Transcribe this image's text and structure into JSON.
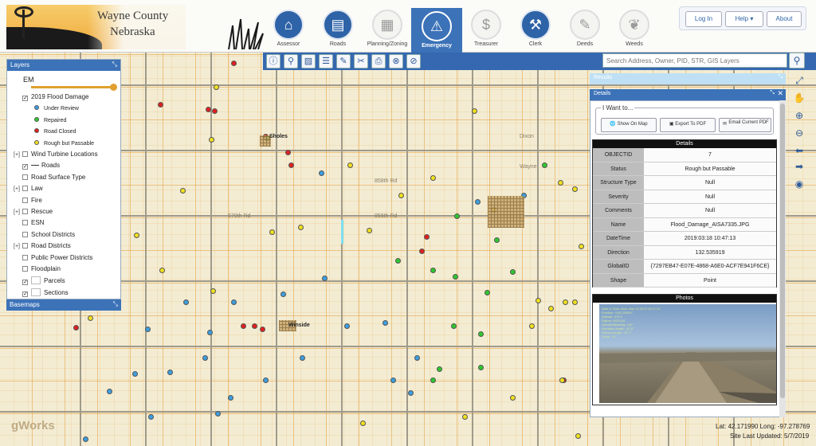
{
  "header": {
    "county": "Wayne County",
    "state": "Nebraska",
    "nav": [
      {
        "label": "Assessor",
        "icon": "house-icon",
        "glyph": "⌂"
      },
      {
        "label": "Roads",
        "icon": "road-icon",
        "glyph": "▤"
      },
      {
        "label": "Planning/Zoning",
        "icon": "blueprint-icon",
        "glyph": "▦"
      },
      {
        "label": "Emergency",
        "icon": "warning-icon",
        "glyph": "⚠"
      },
      {
        "label": "Treasurer",
        "icon": "dollar-icon",
        "glyph": "$"
      },
      {
        "label": "Clerk",
        "icon": "gavel-icon",
        "glyph": "⚒"
      },
      {
        "label": "Deeds",
        "icon": "document-icon",
        "glyph": "✎"
      },
      {
        "label": "Weeds",
        "icon": "leaf-icon",
        "glyph": "❦"
      }
    ],
    "active_nav": "Emergency",
    "buttons": {
      "login": "Log In",
      "help": "Help ▾",
      "about": "About"
    }
  },
  "toolbar": {
    "tools": [
      "info-icon",
      "marker-icon",
      "image-icon",
      "draw-icon",
      "pencil-icon",
      "tools-icon",
      "print-icon",
      "clear-icon",
      "cancel-icon"
    ],
    "search_placeholder": "Search Address, Owner, PID, STR, GIS Layers"
  },
  "layers_panel": {
    "title": "Layers",
    "em_label": "EM",
    "opacity": 1.0,
    "items": [
      {
        "label": "2019 Flood Damage",
        "checked": true,
        "expander": "",
        "indent": 1
      },
      {
        "label": "Under Review",
        "legend_color": "#3d9ee0",
        "legend": "dot"
      },
      {
        "label": "Repaired",
        "legend_color": "#2ec82e",
        "legend": "dot"
      },
      {
        "label": "Road Closed",
        "legend_color": "#e02020",
        "legend": "dot"
      },
      {
        "label": "Rough but Passable",
        "legend_color": "#f0e020",
        "legend": "dot"
      },
      {
        "label": "Wind Turbine Locations",
        "checked": false,
        "expander": "[+]",
        "indent": 0
      },
      {
        "label": "Roads",
        "checked": true,
        "expander": "",
        "indent": 1,
        "legend": "line"
      },
      {
        "label": "Road Surface Type",
        "checked": false,
        "expander": "",
        "indent": 1
      },
      {
        "label": "Law",
        "checked": false,
        "expander": "[+]",
        "indent": 0
      },
      {
        "label": "Fire",
        "checked": false,
        "expander": "",
        "indent": 1
      },
      {
        "label": "Rescue",
        "checked": false,
        "expander": "[+]",
        "indent": 0
      },
      {
        "label": "ESN",
        "checked": false,
        "expander": "",
        "indent": 1
      },
      {
        "label": "School Districts",
        "checked": false,
        "expander": "",
        "indent": 1
      },
      {
        "label": "Road Districts",
        "checked": false,
        "expander": "[+]",
        "indent": 0
      },
      {
        "label": "Public Power Districts",
        "checked": false,
        "expander": "",
        "indent": 1
      },
      {
        "label": "Floodplain",
        "checked": false,
        "expander": "",
        "indent": 1
      },
      {
        "label": "Parcels",
        "checked": true,
        "expander": "",
        "indent": 1,
        "legend": "box"
      },
      {
        "label": "Sections",
        "checked": true,
        "expander": "",
        "indent": 1,
        "legend": "box"
      }
    ],
    "basemaps_title": "Basemaps"
  },
  "results_panel": {
    "results_title": "Results",
    "details_title": "Details"
  },
  "i_want_to": {
    "legend": "I Want to...",
    "actions": [
      "Show On Map",
      "Export To PDF",
      "Email Current PDF"
    ]
  },
  "details": {
    "title": "Details",
    "rows": [
      {
        "key": "OBJECTID",
        "value": "7"
      },
      {
        "key": "Status",
        "value": "Rough but Passable"
      },
      {
        "key": "Structure Type",
        "value": "Null"
      },
      {
        "key": "Severity",
        "value": "Null"
      },
      {
        "key": "Comments",
        "value": "Null"
      },
      {
        "key": "Name",
        "value": "Flood_Damage_AISA7335.JPG"
      },
      {
        "key": "DateTime",
        "value": "2019:03:18 10:47:13"
      },
      {
        "key": "Direction",
        "value": "132.535919"
      },
      {
        "key": "GlobalID",
        "value": "{7297EB47-E07E-4868-A6E0-ACF7E941F6CE}"
      },
      {
        "key": "Shape",
        "value": "Point"
      }
    ]
  },
  "photos": {
    "title": "Photos"
  },
  "map": {
    "towns": [
      "Dixon",
      "Wayne",
      "Sholes",
      "Winside"
    ],
    "road_labels": [
      "570th Rd",
      "856th Rd",
      "858th Rd"
    ]
  },
  "footer": {
    "coords": "Lat: 42.171990  Long: -97.278769",
    "updated": "Site Last Updated: 5/7/2019",
    "brand": "gWorks"
  },
  "colors": {
    "accent": "#2e63a8",
    "review": "#3d9ee0",
    "repaired": "#2ec82e",
    "closed": "#e02020",
    "passable": "#f0e020"
  }
}
